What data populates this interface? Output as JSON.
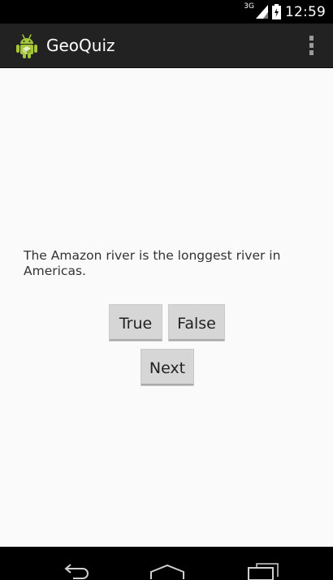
{
  "status_bar": {
    "network": "3G",
    "time": "12:59",
    "icons": [
      "signal-icon",
      "battery-icon"
    ]
  },
  "action_bar": {
    "title": "GeoQuiz",
    "app_icon": "android-icon",
    "menu_icon": "overflow-menu-icon"
  },
  "quiz": {
    "question": "The Amazon river is the longgest river in Americas.",
    "true_label": "True",
    "false_label": "False",
    "next_label": "Next"
  },
  "nav_bar": {
    "icons": [
      "back-icon",
      "home-icon",
      "recents-icon"
    ]
  },
  "colors": {
    "status_bar": "#000000",
    "action_bar": "#222222",
    "content_bg": "#fafafa",
    "button_bg": "#d6d6d6",
    "android_green": "#a4c639"
  }
}
